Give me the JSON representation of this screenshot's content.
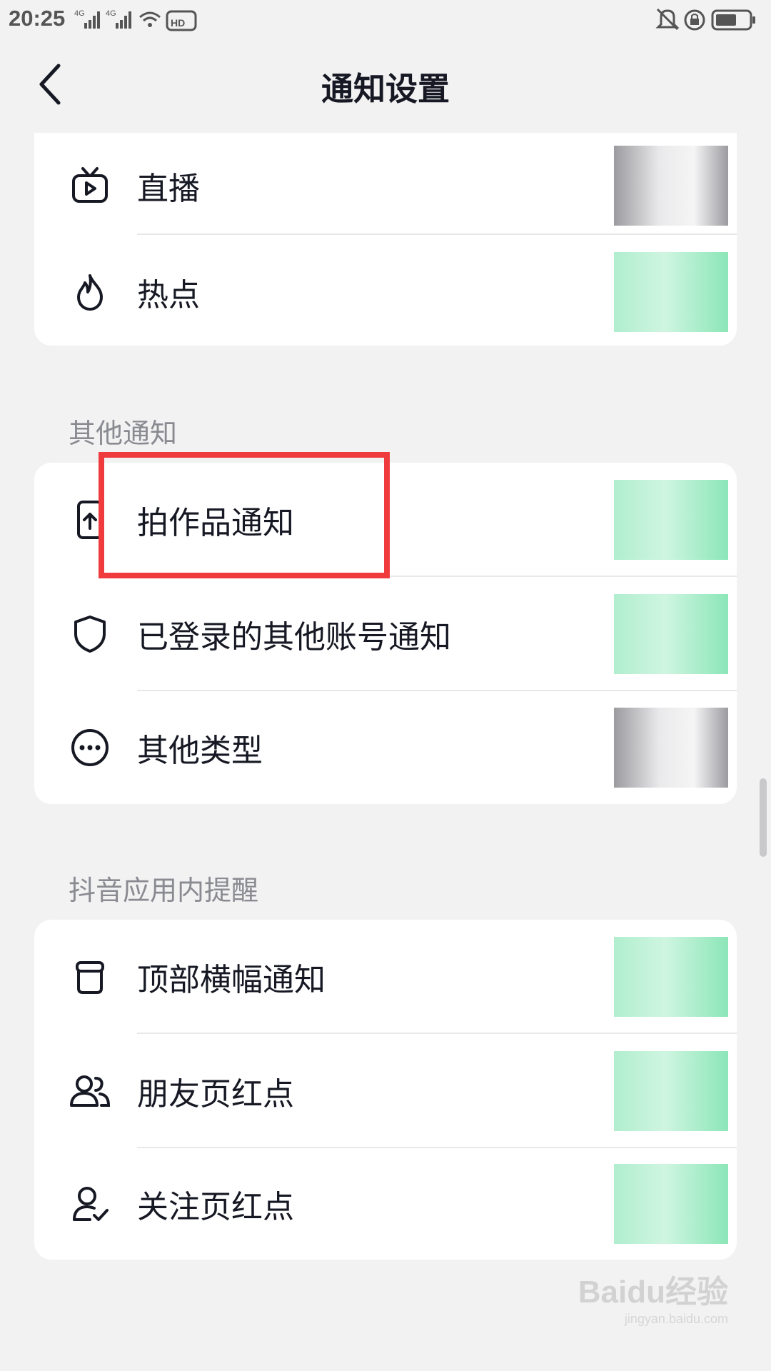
{
  "status_bar": {
    "time": "20:25",
    "network_1": "4G",
    "network_2": "4G",
    "icons_left": [
      "signal-icon",
      "signal-icon",
      "wifi-icon",
      "hd-icon"
    ],
    "icons_right": [
      "mute-icon",
      "rotation-lock-icon",
      "battery-icon"
    ]
  },
  "header": {
    "title": "通知设置"
  },
  "section_1": {
    "items": [
      {
        "label": "直播",
        "icon": "live-tv-icon",
        "toggle": "off"
      },
      {
        "label": "热点",
        "icon": "flame-icon",
        "toggle": "on"
      }
    ]
  },
  "section_2": {
    "title": "其他通知",
    "items": [
      {
        "label": "拍作品通知",
        "icon": "upload-phone-icon",
        "toggle": "on"
      },
      {
        "label": "已登录的其他账号通知",
        "icon": "shield-icon",
        "toggle": "on"
      },
      {
        "label": "其他类型",
        "icon": "more-circle-icon",
        "toggle": "off"
      }
    ]
  },
  "section_3": {
    "title": "抖音应用内提醒",
    "items": [
      {
        "label": "顶部横幅通知",
        "icon": "banner-icon",
        "toggle": "on"
      },
      {
        "label": "朋友页红点",
        "icon": "friends-icon",
        "toggle": "on"
      },
      {
        "label": "关注页红点",
        "icon": "follow-icon",
        "toggle": "on"
      }
    ]
  },
  "watermark": {
    "brand": "Baidu经验",
    "url": "jingyan.baidu.com"
  },
  "colors": {
    "highlight": "#ef3b3e",
    "toggle_on": "#7fe3b0",
    "text": "#161823",
    "section_text": "#8a8b91"
  }
}
